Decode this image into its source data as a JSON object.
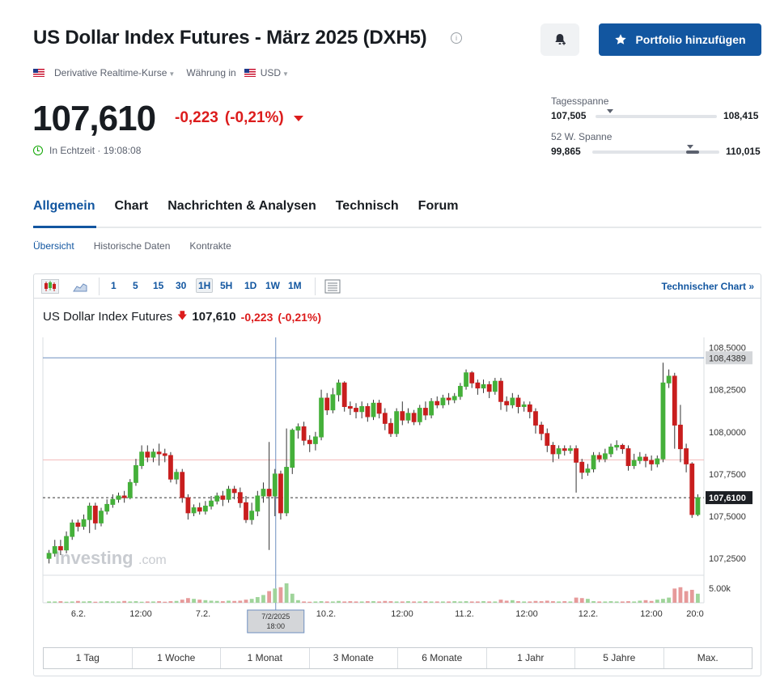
{
  "header": {
    "title": "US Dollar Index Futures - März 2025 (DXH5)",
    "portfolio_button": "Portfolio hinzufügen",
    "source_label": "Derivative Realtime-Kurse",
    "currency_label": "Währung in",
    "currency": "USD"
  },
  "quote": {
    "price": "107,610",
    "change": "-0,223",
    "change_pct": "(-0,21%)",
    "realtime": "In Echtzeit · 19:08:08"
  },
  "ranges": {
    "day_label": "Tagesspanne",
    "day_low": "107,505",
    "day_high": "108,415",
    "week52_label": "52 W. Spanne",
    "week52_low": "99,865",
    "week52_high": "110,015",
    "day_position": 0.12,
    "week52_position": 0.77
  },
  "tabs": [
    "Allgemein",
    "Chart",
    "Nachrichten & Analysen",
    "Technisch",
    "Forum"
  ],
  "subtabs": [
    "Übersicht",
    "Historische Daten",
    "Kontrakte"
  ],
  "toolbar": {
    "intervals": [
      "1",
      "5",
      "15",
      "30",
      "1H",
      "5H",
      "1D",
      "1W",
      "1M"
    ],
    "active_interval": "1H",
    "tech_link": "Technischer Chart »"
  },
  "chart_header": {
    "name": "US Dollar Index Futures",
    "price": "107,610",
    "change": "-0,223",
    "change_pct": "(-0,21%)"
  },
  "chart_data": {
    "type": "candlestick",
    "y_ticks": [
      "108,5000",
      "108,2500",
      "108,0000",
      "107,7500",
      "107,5000",
      "107,2500"
    ],
    "y_tick_values": [
      108.5,
      108.25,
      108.0,
      107.75,
      107.5,
      107.25
    ],
    "ylim": [
      107.15,
      108.56
    ],
    "x_ticks": [
      "6.2.",
      "12:00",
      "7.2.",
      "12:00",
      "10.2.",
      "12:00",
      "11.2.",
      "12:00",
      "12.2.",
      "12:00",
      "20:0"
    ],
    "last_price_label": "107,6100",
    "last_price": 107.61,
    "high_line_label": "108,4389",
    "high_line": 108.4389,
    "volume_label": "5.00k",
    "crosshair_label": [
      "7/2/2025",
      "18:00"
    ],
    "watermark": "Investing",
    "watermark_suffix": ".com",
    "candles": [
      [
        107.25,
        107.28,
        107.22,
        107.3
      ],
      [
        107.28,
        107.32,
        107.26,
        107.36
      ],
      [
        107.32,
        107.3,
        107.27,
        107.36
      ],
      [
        107.3,
        107.38,
        107.28,
        107.41
      ],
      [
        107.38,
        107.46,
        107.36,
        107.48
      ],
      [
        107.46,
        107.44,
        107.41,
        107.48
      ],
      [
        107.44,
        107.48,
        107.42,
        107.51
      ],
      [
        107.48,
        107.56,
        107.4,
        107.58
      ],
      [
        107.56,
        107.46,
        107.42,
        107.58
      ],
      [
        107.46,
        107.53,
        107.44,
        107.55
      ],
      [
        107.53,
        107.57,
        107.51,
        107.6
      ],
      [
        107.57,
        107.6,
        107.55,
        107.63
      ],
      [
        107.6,
        107.62,
        107.58,
        107.64
      ],
      [
        107.62,
        107.61,
        107.58,
        107.65
      ],
      [
        107.61,
        107.7,
        107.6,
        107.72
      ],
      [
        107.7,
        107.8,
        107.68,
        107.84
      ],
      [
        107.8,
        107.88,
        107.78,
        107.92
      ],
      [
        107.88,
        107.85,
        107.82,
        107.92
      ],
      [
        107.85,
        107.88,
        107.82,
        107.9
      ],
      [
        107.88,
        107.87,
        107.8,
        107.93
      ],
      [
        107.87,
        107.86,
        107.82,
        107.9
      ],
      [
        107.86,
        107.72,
        107.7,
        107.88
      ],
      [
        107.72,
        107.76,
        107.69,
        107.78
      ],
      [
        107.76,
        107.61,
        107.58,
        107.78
      ],
      [
        107.61,
        107.52,
        107.48,
        107.63
      ],
      [
        107.52,
        107.55,
        107.5,
        107.57
      ],
      [
        107.55,
        107.53,
        107.51,
        107.58
      ],
      [
        107.53,
        107.56,
        107.51,
        107.59
      ],
      [
        107.56,
        107.59,
        107.54,
        107.62
      ],
      [
        107.59,
        107.62,
        107.57,
        107.64
      ],
      [
        107.62,
        107.6,
        107.56,
        107.65
      ],
      [
        107.6,
        107.66,
        107.58,
        107.68
      ],
      [
        107.66,
        107.64,
        107.6,
        107.68
      ],
      [
        107.64,
        107.58,
        107.55,
        107.67
      ],
      [
        107.58,
        107.48,
        107.46,
        107.62
      ],
      [
        107.48,
        107.53,
        107.45,
        107.58
      ],
      [
        107.53,
        107.62,
        107.5,
        107.65
      ],
      [
        107.62,
        107.66,
        107.58,
        107.7
      ],
      [
        107.66,
        107.62,
        107.3,
        107.94
      ],
      [
        107.62,
        107.75,
        107.5,
        107.78
      ],
      [
        107.75,
        107.52,
        107.48,
        107.77
      ],
      [
        107.52,
        107.79,
        107.5,
        108.02
      ],
      [
        107.79,
        108.01,
        107.75,
        108.02
      ],
      [
        108.01,
        108.03,
        107.96,
        108.05
      ],
      [
        108.03,
        107.95,
        107.92,
        108.06
      ],
      [
        107.95,
        107.93,
        107.88,
        107.98
      ],
      [
        107.93,
        107.97,
        107.89,
        108.0
      ],
      [
        107.97,
        108.2,
        107.95,
        108.25
      ],
      [
        108.2,
        108.13,
        108.1,
        108.23
      ],
      [
        108.13,
        108.22,
        108.11,
        108.26
      ],
      [
        108.22,
        108.29,
        108.18,
        108.31
      ],
      [
        108.29,
        108.15,
        108.12,
        108.3
      ],
      [
        108.15,
        108.14,
        108.1,
        108.18
      ],
      [
        108.14,
        108.12,
        108.08,
        108.17
      ],
      [
        108.12,
        108.15,
        108.08,
        108.18
      ],
      [
        108.15,
        108.09,
        108.06,
        108.17
      ],
      [
        108.09,
        108.17,
        108.07,
        108.19
      ],
      [
        108.17,
        108.11,
        108.08,
        108.19
      ],
      [
        108.11,
        108.05,
        108.01,
        108.14
      ],
      [
        108.05,
        107.99,
        107.97,
        108.08
      ],
      [
        107.99,
        108.12,
        107.97,
        108.14
      ],
      [
        108.12,
        108.07,
        108.04,
        108.18
      ],
      [
        108.07,
        108.11,
        108.05,
        108.14
      ],
      [
        108.11,
        108.06,
        108.04,
        108.13
      ],
      [
        108.06,
        108.14,
        108.04,
        108.16
      ],
      [
        108.14,
        108.1,
        108.07,
        108.18
      ],
      [
        108.1,
        108.18,
        108.08,
        108.2
      ],
      [
        108.18,
        108.16,
        108.14,
        108.21
      ],
      [
        108.16,
        108.2,
        108.14,
        108.22
      ],
      [
        108.2,
        108.19,
        108.16,
        108.23
      ],
      [
        108.19,
        108.21,
        108.17,
        108.23
      ],
      [
        108.21,
        108.27,
        108.19,
        108.29
      ],
      [
        108.27,
        108.35,
        108.25,
        108.37
      ],
      [
        108.35,
        108.29,
        108.26,
        108.36
      ],
      [
        108.29,
        108.26,
        108.22,
        108.31
      ],
      [
        108.26,
        108.28,
        108.23,
        108.31
      ],
      [
        108.28,
        108.24,
        108.2,
        108.3
      ],
      [
        108.24,
        108.3,
        108.22,
        108.32
      ],
      [
        108.3,
        108.18,
        108.13,
        108.32
      ],
      [
        108.18,
        108.16,
        108.12,
        108.21
      ],
      [
        108.16,
        108.2,
        108.14,
        108.23
      ],
      [
        108.2,
        108.15,
        108.11,
        108.22
      ],
      [
        108.15,
        108.16,
        108.12,
        108.18
      ],
      [
        108.16,
        108.12,
        108.08,
        108.18
      ],
      [
        108.12,
        108.04,
        107.99,
        108.14
      ],
      [
        108.04,
        107.99,
        107.95,
        108.06
      ],
      [
        107.99,
        107.92,
        107.88,
        108.02
      ],
      [
        107.92,
        107.87,
        107.82,
        107.94
      ],
      [
        107.87,
        107.9,
        107.84,
        107.92
      ],
      [
        107.9,
        107.89,
        107.86,
        107.92
      ],
      [
        107.89,
        107.9,
        107.87,
        107.92
      ],
      [
        107.9,
        107.82,
        107.64,
        107.92
      ],
      [
        107.82,
        107.76,
        107.72,
        107.84
      ],
      [
        107.76,
        107.78,
        107.74,
        107.81
      ],
      [
        107.78,
        107.86,
        107.76,
        107.88
      ],
      [
        107.86,
        107.84,
        107.82,
        107.88
      ],
      [
        107.84,
        107.87,
        107.82,
        107.9
      ],
      [
        107.87,
        107.91,
        107.85,
        107.93
      ],
      [
        107.91,
        107.92,
        107.89,
        107.95
      ],
      [
        107.92,
        107.9,
        107.87,
        107.93
      ],
      [
        107.9,
        107.8,
        107.77,
        107.92
      ],
      [
        107.8,
        107.83,
        107.78,
        107.87
      ],
      [
        107.83,
        107.85,
        107.81,
        107.88
      ],
      [
        107.85,
        107.83,
        107.79,
        107.87
      ],
      [
        107.83,
        107.81,
        107.77,
        107.86
      ],
      [
        107.81,
        107.84,
        107.79,
        107.86
      ],
      [
        107.84,
        108.29,
        107.82,
        108.41
      ],
      [
        108.29,
        108.33,
        108.26,
        108.37
      ],
      [
        108.33,
        108.04,
        107.9,
        108.35
      ],
      [
        108.04,
        107.9,
        107.82,
        108.16
      ],
      [
        107.9,
        107.81,
        107.76,
        107.93
      ],
      [
        107.81,
        107.51,
        107.49,
        107.82
      ],
      [
        107.51,
        107.61,
        107.5,
        107.63
      ]
    ],
    "volumes": [
      0.05,
      0.05,
      0.06,
      0.04,
      0.05,
      0.07,
      0.05,
      0.06,
      0.04,
      0.05,
      0.06,
      0.05,
      0.05,
      0.07,
      0.05,
      0.06,
      0.04,
      0.05,
      0.05,
      0.06,
      0.04,
      0.06,
      0.07,
      0.12,
      0.18,
      0.15,
      0.12,
      0.1,
      0.08,
      0.07,
      0.06,
      0.08,
      0.07,
      0.08,
      0.12,
      0.15,
      0.22,
      0.3,
      0.45,
      0.55,
      0.6,
      0.75,
      0.35,
      0.1,
      0.05,
      0.04,
      0.05,
      0.06,
      0.05,
      0.05,
      0.07,
      0.05,
      0.06,
      0.05,
      0.05,
      0.06,
      0.06,
      0.05,
      0.07,
      0.06,
      0.05,
      0.05,
      0.06,
      0.05,
      0.05,
      0.06,
      0.05,
      0.05,
      0.05,
      0.05,
      0.06,
      0.05,
      0.06,
      0.05,
      0.05,
      0.06,
      0.05,
      0.05,
      0.12,
      0.08,
      0.1,
      0.06,
      0.05,
      0.05,
      0.07,
      0.06,
      0.08,
      0.06,
      0.05,
      0.06,
      0.05,
      0.2,
      0.18,
      0.15,
      0.06,
      0.05,
      0.05,
      0.06,
      0.05,
      0.05,
      0.06,
      0.05,
      0.08,
      0.1,
      0.07,
      0.12,
      0.15,
      0.2,
      0.55,
      0.6,
      0.45,
      0.5,
      0.35,
      0.42,
      0.25
    ]
  },
  "periods": [
    "1 Tag",
    "1 Woche",
    "1 Monat",
    "3 Monate",
    "6 Monate",
    "1 Jahr",
    "5 Jahre",
    "Max."
  ],
  "colors": {
    "accent": "#1256a0",
    "negative": "#dc1c1c",
    "up_candle": "#45b03a",
    "down_candle": "#c81e1e"
  }
}
